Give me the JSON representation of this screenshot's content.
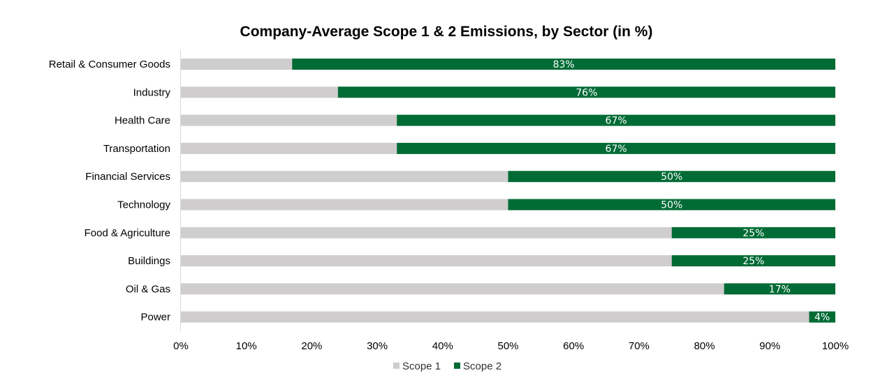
{
  "chart_data": {
    "type": "bar",
    "orientation": "horizontal",
    "stacked": true,
    "title": "Company-Average Scope 1 & 2 Emissions, by Sector (in %)",
    "xlabel": "",
    "ylabel": "",
    "xlim": [
      0,
      100
    ],
    "x_ticks": [
      "0%",
      "10%",
      "20%",
      "30%",
      "40%",
      "50%",
      "60%",
      "70%",
      "80%",
      "90%",
      "100%"
    ],
    "grid": false,
    "legend_position": "bottom",
    "categories": [
      "Retail & Consumer Goods",
      "Industry",
      "Health Care",
      "Transportation",
      "Financial Services",
      "Technology",
      "Food & Agriculture",
      "Buildings",
      "Oil & Gas",
      "Power"
    ],
    "series": [
      {
        "name": "Scope 1",
        "color": "#cfcdcd",
        "values": [
          17,
          24,
          33,
          33,
          50,
          50,
          75,
          75,
          83,
          96
        ],
        "show_labels": false
      },
      {
        "name": "Scope 2",
        "color": "#006b35",
        "values": [
          83,
          76,
          67,
          67,
          50,
          50,
          25,
          25,
          17,
          4
        ],
        "show_labels": true
      }
    ],
    "data_labels": [
      "83%",
      "76%",
      "67%",
      "67%",
      "50%",
      "50%",
      "25%",
      "25%",
      "17%",
      "4%"
    ]
  }
}
